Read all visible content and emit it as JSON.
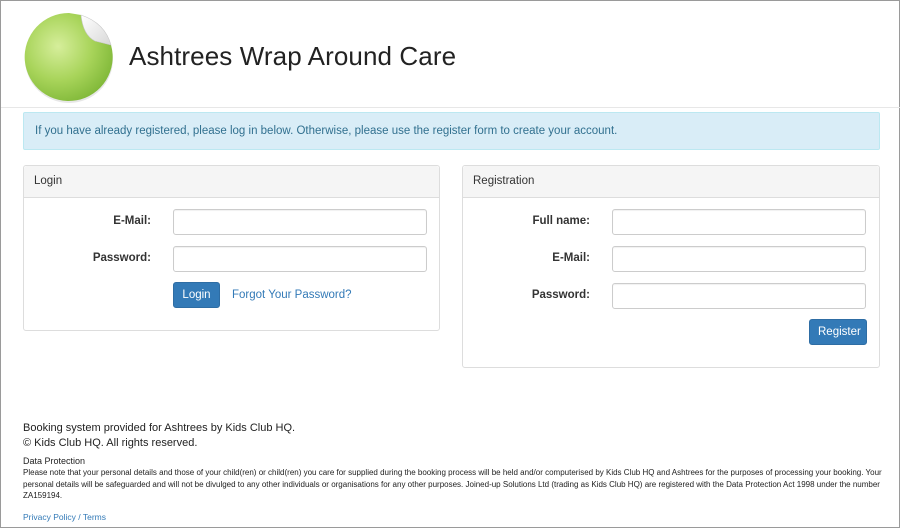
{
  "header": {
    "title": "Ashtrees Wrap Around Care",
    "logo_icon": "green-sticker-logo-icon"
  },
  "alert": {
    "text": "If you have already registered, please log in below. Otherwise, please use the register form to create your account."
  },
  "login": {
    "heading": "Login",
    "email_label": "E-Mail:",
    "email_value": "",
    "password_label": "Password:",
    "password_value": "",
    "submit_label": "Login",
    "forgot_link": "Forgot Your Password?"
  },
  "registration": {
    "heading": "Registration",
    "fullname_label": "Full name:",
    "fullname_value": "",
    "email_label": "E-Mail:",
    "email_value": "",
    "password_label": "Password:",
    "password_value": "",
    "submit_label": "Register"
  },
  "footer": {
    "provided_by": "Booking system provided for Ashtrees by Kids Club HQ.",
    "copyright": "© Kids Club HQ. All rights reserved.",
    "data_protection_title": "Data Protection",
    "data_protection_text": "Please note that your personal details and those of your child(ren) or child(ren) you care for supplied during the booking process will be held and/or computerised by Kids Club HQ and Ashtrees for the purposes of processing your booking. Your personal details will be safeguarded and will not be divulged to any other individuals or organisations for any other purposes. Joined-up Solutions Ltd (trading as Kids Club HQ) are registered with the Data Protection Act 1998 under the number ZA159194.",
    "privacy_link": "Privacy Policy",
    "separator": " / ",
    "terms_link": "Terms"
  },
  "colors": {
    "primary": "#337ab7",
    "alert_bg": "#d9edf7",
    "alert_text": "#31708f",
    "logo_green": "#8cc63f"
  }
}
